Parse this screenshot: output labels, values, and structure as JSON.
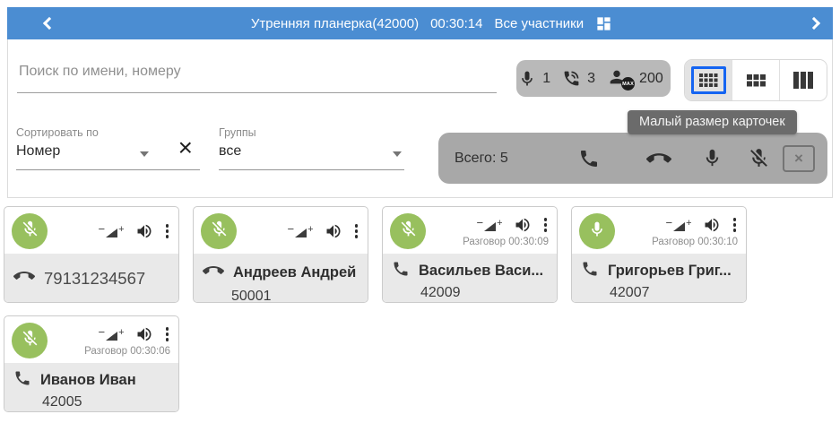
{
  "header": {
    "title": "Утренняя планерка(42000)",
    "timer": "00:30:14",
    "participants_label": "Все участники"
  },
  "search": {
    "placeholder": "Поиск по имени, номеру"
  },
  "stats": {
    "mic": {
      "icon": "microphone-icon",
      "value": "1"
    },
    "calls": {
      "icon": "phone-in-talk-icon",
      "value": "3"
    },
    "max": {
      "icon": "participant-max-icon",
      "badge": "MAX",
      "value": "200"
    }
  },
  "view_toolbar": {
    "tooltip": "Малый размер карточек",
    "buttons": [
      {
        "name": "grid-small",
        "selected": true
      },
      {
        "name": "grid-medium",
        "selected": false
      },
      {
        "name": "grid-large",
        "selected": false
      }
    ]
  },
  "filters": {
    "sort": {
      "label": "Сортировать по",
      "value": "Номер"
    },
    "groups": {
      "label": "Группы",
      "value": "все"
    }
  },
  "summary": {
    "total": "Всего: 5",
    "actions": [
      "call-icon",
      "hangup-icon",
      "microphone-icon",
      "microphone-off-icon",
      "close-box-icon"
    ]
  },
  "cards": [
    {
      "mic": "muted",
      "talk": "",
      "call_state": "hangup",
      "name": "79131234567",
      "number": "",
      "style": "plain"
    },
    {
      "mic": "muted",
      "talk": "",
      "call_state": "hangup",
      "name": "Андреев Андрей",
      "number": "50001",
      "style": "bold"
    },
    {
      "mic": "muted",
      "talk": "Разговор 00:30:09",
      "call_state": "active",
      "name": "Васильев Васи...",
      "number": "42009",
      "style": "bold"
    },
    {
      "mic": "on",
      "talk": "Разговор 00:30:10",
      "call_state": "active",
      "name": "Григорьев Григ...",
      "number": "42007",
      "style": "bold"
    },
    {
      "mic": "muted",
      "talk": "Разговор 00:30:06",
      "call_state": "active",
      "name": "Иванов Иван",
      "number": "42005",
      "style": "bold"
    }
  ],
  "colors": {
    "header_bg": "#4b8dd2",
    "accent_blue": "#1565f2",
    "mic_green": "#98c05e",
    "pill_grey": "#b9b9b9",
    "bar_grey": "#a8a8a8",
    "tooltip_bg": "#6b6b6b",
    "card_footer": "#e9e9e9"
  }
}
